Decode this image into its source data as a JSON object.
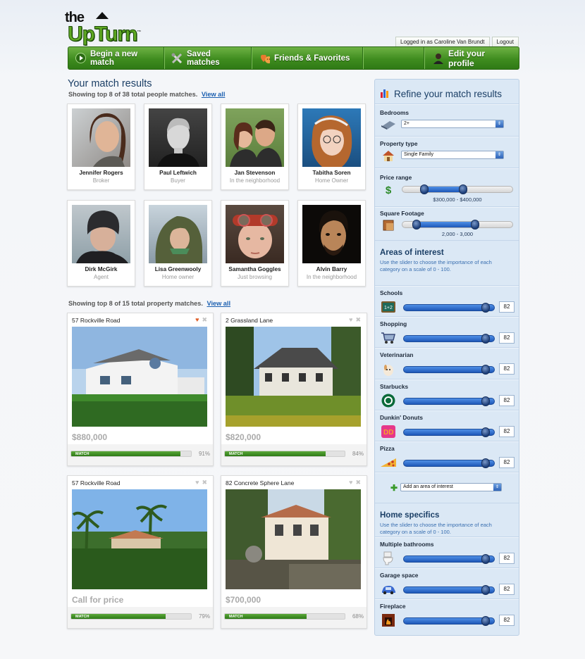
{
  "brand": {
    "the": "the",
    "name": "UpTurn",
    "tm": "™"
  },
  "user": {
    "status": "Logged in as Caroline Van Brundt",
    "logout": "Logout"
  },
  "nav": [
    {
      "label": "Begin a new match",
      "icon": "play-icon"
    },
    {
      "label": "Saved matches",
      "icon": "tools-icon"
    },
    {
      "label": "Friends & Favorites",
      "icon": "friends-icon"
    },
    {
      "label": "Edit your profile",
      "icon": "profile-icon"
    }
  ],
  "people_section": {
    "title": "Your match results",
    "summary": "Showing top 8 of 38 total people matches.",
    "view_all": "View all",
    "people": [
      {
        "name": "Jennifer Rogers",
        "role": "Broker"
      },
      {
        "name": "Paul Leftwich",
        "role": "Buyer"
      },
      {
        "name": "Jan Stevenson",
        "role": "In the neighborhood"
      },
      {
        "name": "Tabitha Soren",
        "role": "Home Owner"
      },
      {
        "name": "Dirk McGirk",
        "role": "Agent"
      },
      {
        "name": "Lisa Greenwooly",
        "role": "Home owner"
      },
      {
        "name": "Samantha Goggles",
        "role": "Just browsing"
      },
      {
        "name": "Alvin Barry",
        "role": "In the neighborhood"
      }
    ]
  },
  "property_section": {
    "summary": "Showing top 8 of 15 total property matches.",
    "view_all": "View all",
    "properties": [
      {
        "address": "57 Rockville Road",
        "price": "$880,000",
        "match_label": "MATCH",
        "match_pct": "91%",
        "match": 0.91,
        "favorited": true
      },
      {
        "address": "2 Grassland Lane",
        "price": "$820,000",
        "match_label": "MATCH",
        "match_pct": "84%",
        "match": 0.84,
        "favorited": false
      },
      {
        "address": "57 Rockville Road",
        "price": "Call for price",
        "match_label": "MATCH",
        "match_pct": "79%",
        "match": 0.79,
        "favorited": false
      },
      {
        "address": "82 Concrete Sphere Lane",
        "price": "$700,000",
        "match_label": "MATCH",
        "match_pct": "68%",
        "match": 0.68,
        "favorited": false
      }
    ]
  },
  "refine": {
    "title": "Refine your match results",
    "bedrooms": {
      "label": "Bedrooms",
      "value": "2+"
    },
    "property_type": {
      "label": "Property type",
      "value": "Single Family"
    },
    "price_range": {
      "label": "Price range",
      "text": "$300,000 - $400,000",
      "low": 0.2,
      "high": 0.55
    },
    "square_footage": {
      "label": "Square Footage",
      "text": "2,000 - 3,000",
      "low": 0.13,
      "high": 0.66
    },
    "areas": {
      "title": "Areas of interest",
      "description": "Use the slider to choose the importance of each category on a scale of 0 - 100.",
      "items": [
        {
          "label": "Schools",
          "value": "82",
          "icon": "chalkboard-icon"
        },
        {
          "label": "Shopping",
          "value": "82",
          "icon": "shopping-cart-icon"
        },
        {
          "label": "Veterinarian",
          "value": "82",
          "icon": "dog-icon"
        },
        {
          "label": "Starbucks",
          "value": "82",
          "icon": "starbucks-icon"
        },
        {
          "label": "Dunkin' Donuts",
          "value": "82",
          "icon": "dunkin-icon"
        },
        {
          "label": "Pizza",
          "value": "82",
          "icon": "pizza-icon"
        }
      ],
      "add_placeholder": "Add an area of interest"
    },
    "home": {
      "title": "Home specifics",
      "description": "Use the slider to choose the importance of each category on a scale of 0 - 100.",
      "items": [
        {
          "label": "Multiple bathrooms",
          "value": "82",
          "icon": "toilet-icon"
        },
        {
          "label": "Garage space",
          "value": "82",
          "icon": "car-icon"
        },
        {
          "label": "Fireplace",
          "value": "82",
          "icon": "fireplace-icon"
        }
      ]
    }
  },
  "colors": {
    "brand_green": "#3f8c1f",
    "link_blue": "#1b5fb0",
    "panel_bg": "#dbe8f5"
  }
}
